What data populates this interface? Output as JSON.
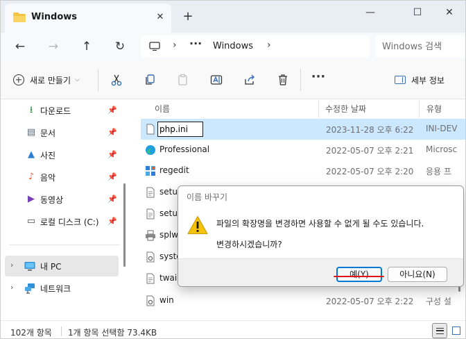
{
  "tab": {
    "title": "Windows",
    "close_glyph": "✕",
    "new_tab_glyph": "+"
  },
  "window_controls": {
    "minimize": "—",
    "maximize": "☐",
    "close": "✕"
  },
  "nav": {
    "back": "←",
    "forward": "→",
    "up": "↑",
    "refresh": "↻"
  },
  "address": {
    "ellipsis": "···",
    "crumb": "Windows",
    "chevron": "›"
  },
  "search": {
    "placeholder": "Windows 검색"
  },
  "commandbar": {
    "new_label": "새로 만들기",
    "new_caret": "⌵",
    "more": "···",
    "details_label": "세부 정보",
    "icons": [
      "cut-icon",
      "copy-icon",
      "paste-icon",
      "rename-icon",
      "share-icon",
      "delete-icon"
    ]
  },
  "sidebar": {
    "quick_access": [
      {
        "label": "다운로드",
        "icon": "download-icon",
        "glyph": "⭳",
        "color": "#1f8a3a",
        "pinned": true
      },
      {
        "label": "문서",
        "icon": "documents-icon",
        "glyph": "▤",
        "color": "#5a6a7a",
        "pinned": true
      },
      {
        "label": "사진",
        "icon": "pictures-icon",
        "glyph": "▲",
        "color": "#2a7fd4",
        "pinned": true
      },
      {
        "label": "음악",
        "icon": "music-icon",
        "glyph": "♪",
        "color": "#e0603c",
        "pinned": true
      },
      {
        "label": "동영상",
        "icon": "videos-icon",
        "glyph": "▶",
        "color": "#7a3db8",
        "pinned": true
      },
      {
        "label": "로컬 디스크 (C:)",
        "icon": "drive-icon",
        "glyph": "▭",
        "color": "#4d4d4d",
        "pinned": true
      }
    ],
    "pin_glyph": "📌",
    "tree": [
      {
        "label": "내 PC",
        "icon": "pc-icon",
        "selected": true
      },
      {
        "label": "네트워크",
        "icon": "network-icon",
        "selected": false
      }
    ],
    "expand_glyph": "›"
  },
  "filelist": {
    "columns": {
      "name": "이름",
      "date": "수정한 날짜",
      "type": "유형"
    },
    "sort_glyph": "⌃",
    "rows": [
      {
        "name": "php.ini",
        "date": "2023-11-28 오후 6:22",
        "type": "INI-DEV",
        "icon": "file-icon",
        "selected": true,
        "renaming": true
      },
      {
        "name": "Professional",
        "date": "2022-05-07 오후 2:21",
        "type": "Microsc",
        "icon": "edge-icon"
      },
      {
        "name": "regedit",
        "date": "2022-05-07 오후 2:20",
        "type": "응용 프",
        "icon": "regedit-icon"
      },
      {
        "name": "setup",
        "date": "",
        "type": "",
        "icon": "file-icon"
      },
      {
        "name": "setup",
        "date": "",
        "type": "",
        "icon": "file-icon"
      },
      {
        "name": "splwo",
        "date": "",
        "type": "",
        "icon": "printer-icon"
      },
      {
        "name": "syste",
        "date": "",
        "type": "",
        "icon": "settings-file-icon"
      },
      {
        "name": "twain",
        "date": "",
        "type": "",
        "icon": "file-icon"
      },
      {
        "name": "win",
        "date": "2022-05-07 오후 2:22",
        "type": "구성 설",
        "icon": "settings-file-icon"
      }
    ]
  },
  "status": {
    "count": "102개 항목",
    "selection": "1개 항목 선택함 73.4KB"
  },
  "dialog": {
    "title": "이름 바꾸기",
    "message": "파일의 확장명을 변경하면 사용할 수 없게 될 수도 있습니다.",
    "question": "변경하시겠습니까?",
    "yes": "예(Y)",
    "no": "아니요(N)"
  },
  "colors": {
    "selection": "#cce8ff",
    "accent": "#0078d4",
    "annotation": "#e01616"
  }
}
